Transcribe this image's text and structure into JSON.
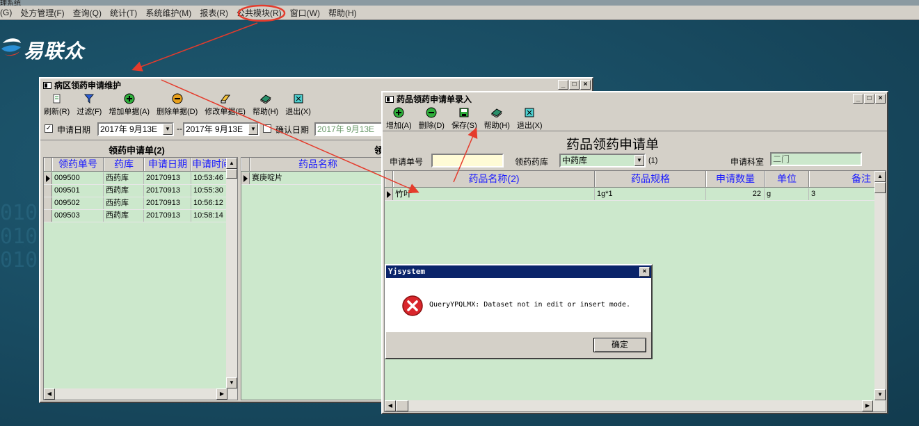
{
  "app": {
    "title_fragment": "理系统"
  },
  "menu": [
    "(G)",
    "处方管理(F)",
    "查询(Q)",
    "统计(T)",
    "系统维护(M)",
    "报表(R)",
    "公共模块(R)",
    "窗口(W)",
    "帮助(H)"
  ],
  "logo": {
    "text": "易联众"
  },
  "win1": {
    "title": "病区领药申请维护",
    "toolbar": [
      "刷新(R)",
      "过滤(F)",
      "增加单据(A)",
      "删除单据(D)",
      "修改单据(E)",
      "帮助(H)",
      "退出(X)"
    ],
    "date_label": "申请日期",
    "date_from": "2017年 9月13E",
    "date_sep": "--",
    "date_to": "2017年 9月13E",
    "confirm_label": "确认日期",
    "confirm_date": "2017年 9月13E",
    "list_title": "领药申请单(2)",
    "right_title_fragment": "领",
    "columns": [
      "领药单号",
      "药库",
      "申请日期",
      "申请时间"
    ],
    "rows": [
      [
        "009500",
        "西药库",
        "20170913",
        "10:53:46"
      ],
      [
        "009501",
        "西药库",
        "20170913",
        "10:55:30"
      ],
      [
        "009502",
        "西药库",
        "20170913",
        "10:56:12"
      ],
      [
        "009503",
        "西药库",
        "20170913",
        "10:58:14"
      ]
    ],
    "detail_column": "药品名称",
    "detail_rows": [
      "赛庚啶片"
    ]
  },
  "win2": {
    "title": "药品领药申请单录入",
    "toolbar": [
      "增加(A)",
      "删除(D)",
      "保存(S)",
      "帮助(H)",
      "退出(X)"
    ],
    "form_title": "药品领药申请单",
    "req_no_label": "申请单号",
    "req_no_value": "",
    "pharmacy_label": "领药药库",
    "pharmacy_value": "中药库",
    "pharmacy_suffix": "(1)",
    "dept_label": "申请科室",
    "dept_value": "二门",
    "columns": [
      "药品名称(2)",
      "药品规格",
      "申请数量",
      "单位",
      "备注"
    ],
    "rows": [
      [
        "竹叶",
        "1g*1",
        "22",
        "g",
        "3"
      ]
    ]
  },
  "dialog": {
    "title": "Yjsystem",
    "message": "QueryYPQLMX: Dataset not in edit or insert mode.",
    "ok": "确定"
  },
  "colors": {
    "accent_red": "#e53b2c",
    "grid_green": "#cce8cc",
    "header_blue": "#1a1aff",
    "dialog_title": "#0a246a"
  }
}
